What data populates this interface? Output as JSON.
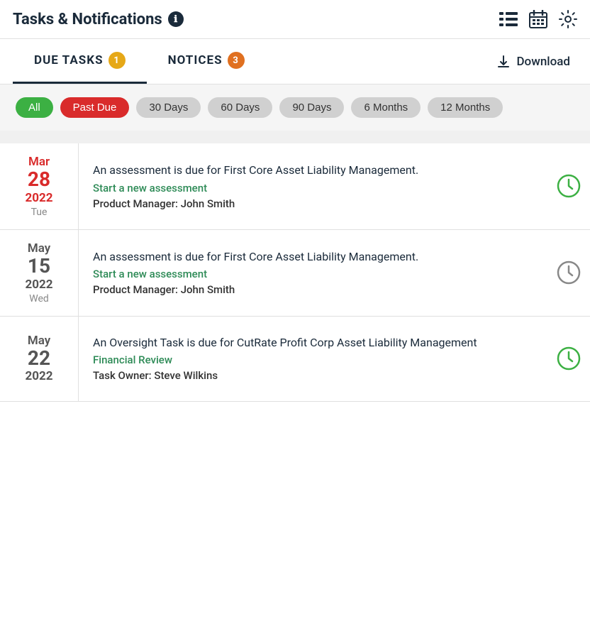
{
  "header": {
    "title": "Tasks & Notifications",
    "info_icon": "ℹ",
    "icons": [
      "list-icon",
      "calendar-icon",
      "settings-icon"
    ]
  },
  "tabs": [
    {
      "id": "due-tasks",
      "label": "DUE TASKS",
      "badge": "1",
      "badge_color": "yellow",
      "active": true
    },
    {
      "id": "notices",
      "label": "NOTICES",
      "badge": "3",
      "badge_color": "orange",
      "active": false
    }
  ],
  "download": {
    "label": "Download",
    "icon": "download-icon"
  },
  "filters": [
    {
      "id": "all",
      "label": "All",
      "style": "green"
    },
    {
      "id": "past-due",
      "label": "Past Due",
      "style": "red"
    },
    {
      "id": "30-days",
      "label": "30 Days",
      "style": "gray"
    },
    {
      "id": "60-days",
      "label": "60 Days",
      "style": "gray"
    },
    {
      "id": "90-days",
      "label": "90 Days",
      "style": "gray"
    },
    {
      "id": "6-months",
      "label": "6 Months",
      "style": "gray"
    },
    {
      "id": "12-months",
      "label": "12 Months",
      "style": "gray"
    }
  ],
  "tasks": [
    {
      "id": "task-1",
      "month": "Mar",
      "day": "28",
      "year": "2022",
      "weekday": "Tue",
      "overdue": true,
      "description": "An assessment is due for First Core Asset Liability Management.",
      "link_label": "Start a new assessment",
      "meta": "Product Manager: John Smith",
      "clock_style": "green"
    },
    {
      "id": "task-2",
      "month": "May",
      "day": "15",
      "year": "2022",
      "weekday": "Wed",
      "overdue": false,
      "description": "An assessment is due for First Core Asset Liability Management.",
      "link_label": "Start a new assessment",
      "meta": "Product Manager: John Smith",
      "clock_style": "gray"
    },
    {
      "id": "task-3",
      "month": "May",
      "day": "22",
      "year": "2022",
      "weekday": "",
      "overdue": false,
      "description": "An Oversight Task is due for CutRate Profit Corp Asset Liability Management",
      "link_label": "Financial Review",
      "meta": "Task Owner: Steve Wilkins",
      "clock_style": "green"
    }
  ]
}
